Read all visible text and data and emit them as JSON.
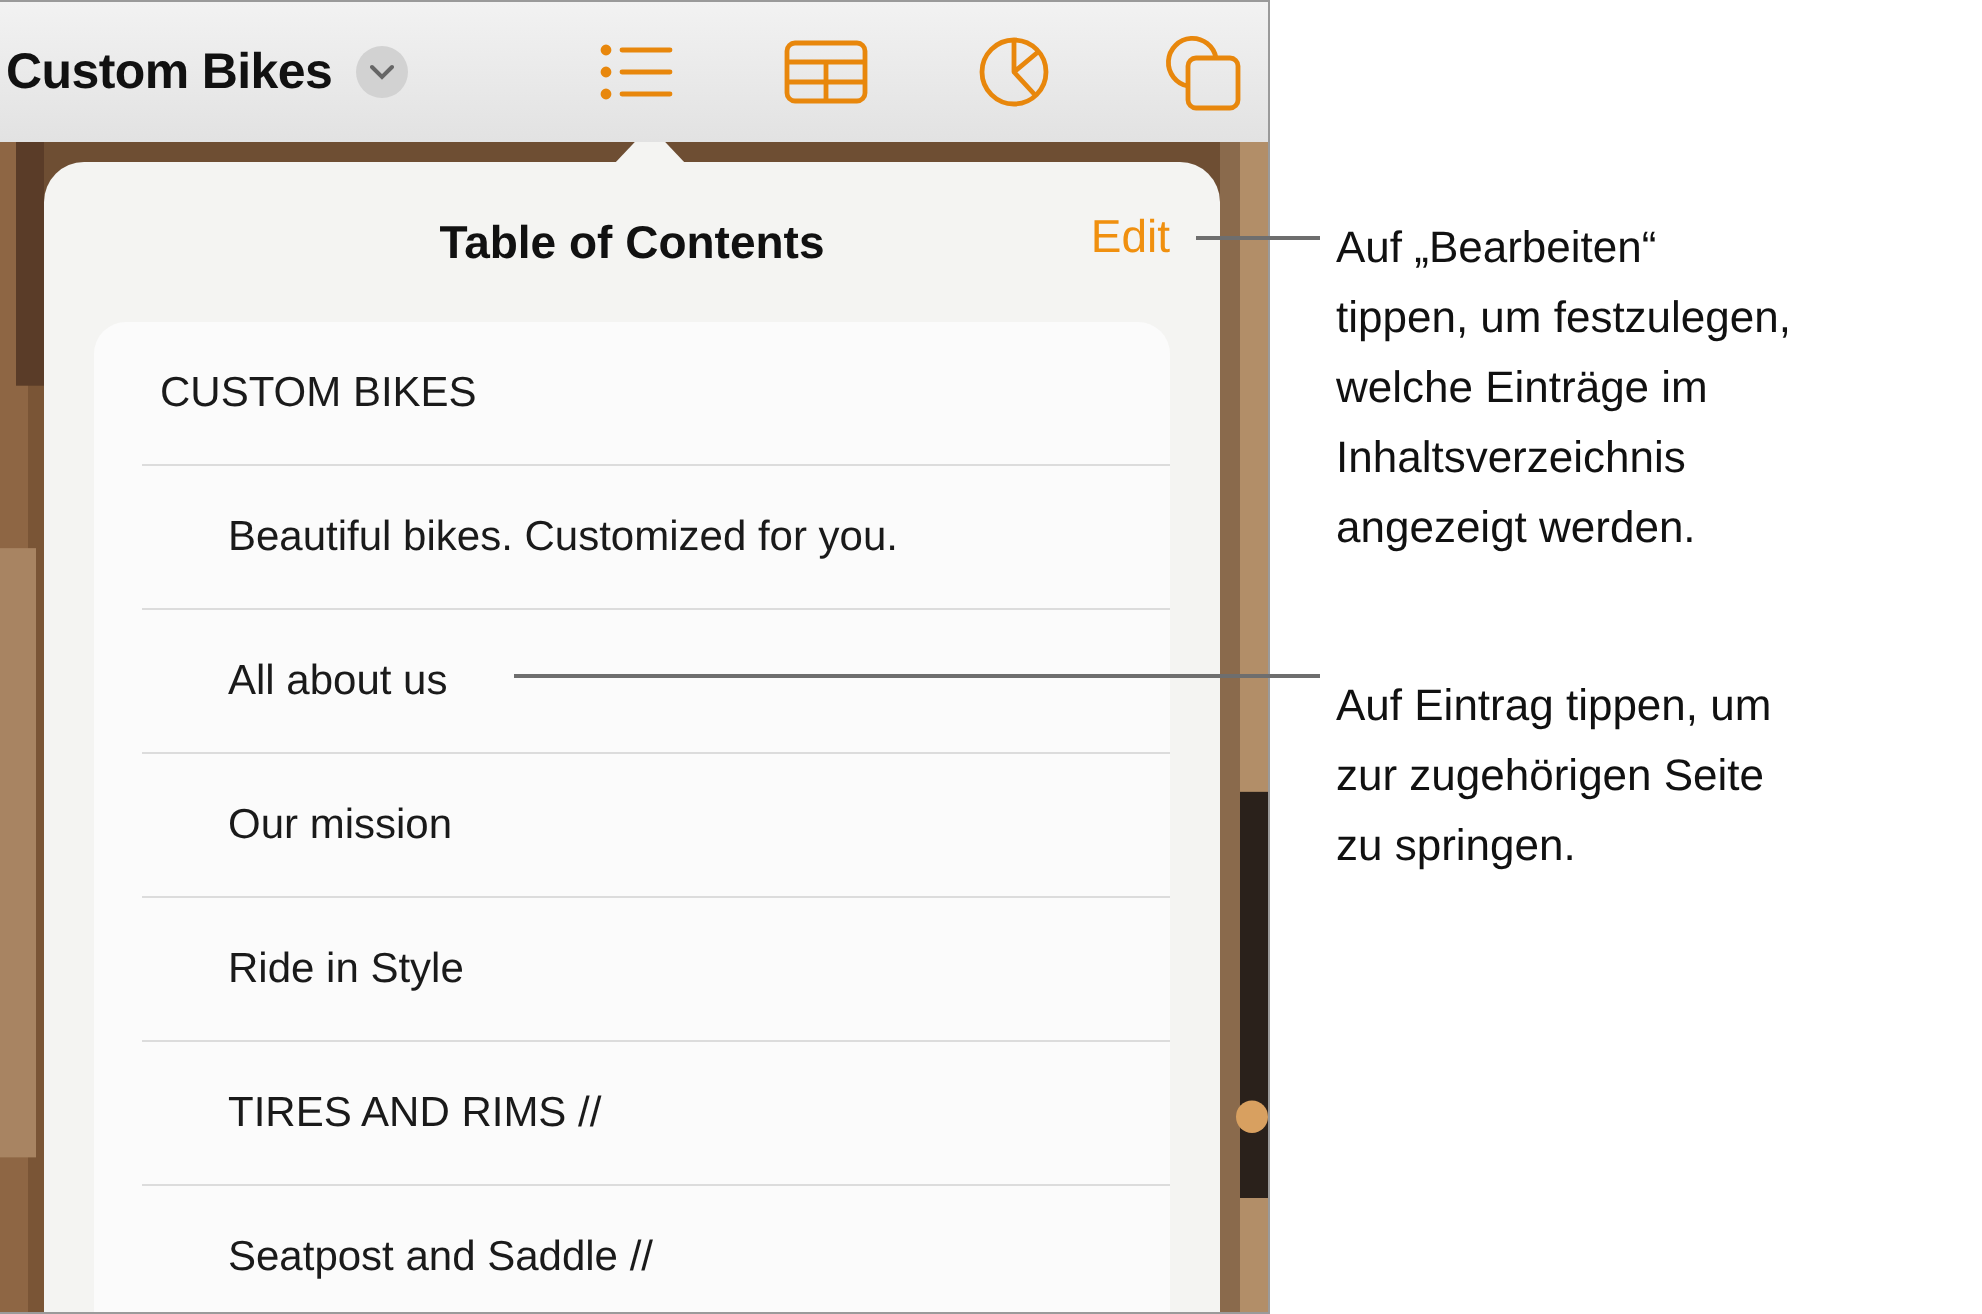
{
  "toolbar": {
    "document_title": "Custom Bikes",
    "tools": [
      {
        "kind": "list"
      },
      {
        "kind": "table"
      },
      {
        "kind": "chart"
      },
      {
        "kind": "shapes"
      }
    ]
  },
  "popover": {
    "title": "Table of Contents",
    "edit_label": "Edit",
    "items": [
      {
        "kind": "heading",
        "label": "CUSTOM  BIKES"
      },
      {
        "kind": "entry",
        "label": "Beautiful bikes. Customized for you."
      },
      {
        "kind": "entry",
        "label": "All about us"
      },
      {
        "kind": "entry",
        "label": "Our mission"
      },
      {
        "kind": "entry",
        "label": "Ride in Style"
      },
      {
        "kind": "entry",
        "label": "TIRES AND RIMS //"
      },
      {
        "kind": "entry",
        "label": "Seatpost and Saddle //"
      }
    ]
  },
  "callouts": [
    {
      "lines": [
        "Auf „Bearbeiten“",
        "tippen, um festzulegen,",
        "welche Einträge im",
        "Inhaltsverzeichnis",
        "angezeigt werden."
      ]
    },
    {
      "lines": [
        "Auf Eintrag tippen, um",
        "zur zugehörigen Seite",
        "zu springen."
      ]
    }
  ]
}
